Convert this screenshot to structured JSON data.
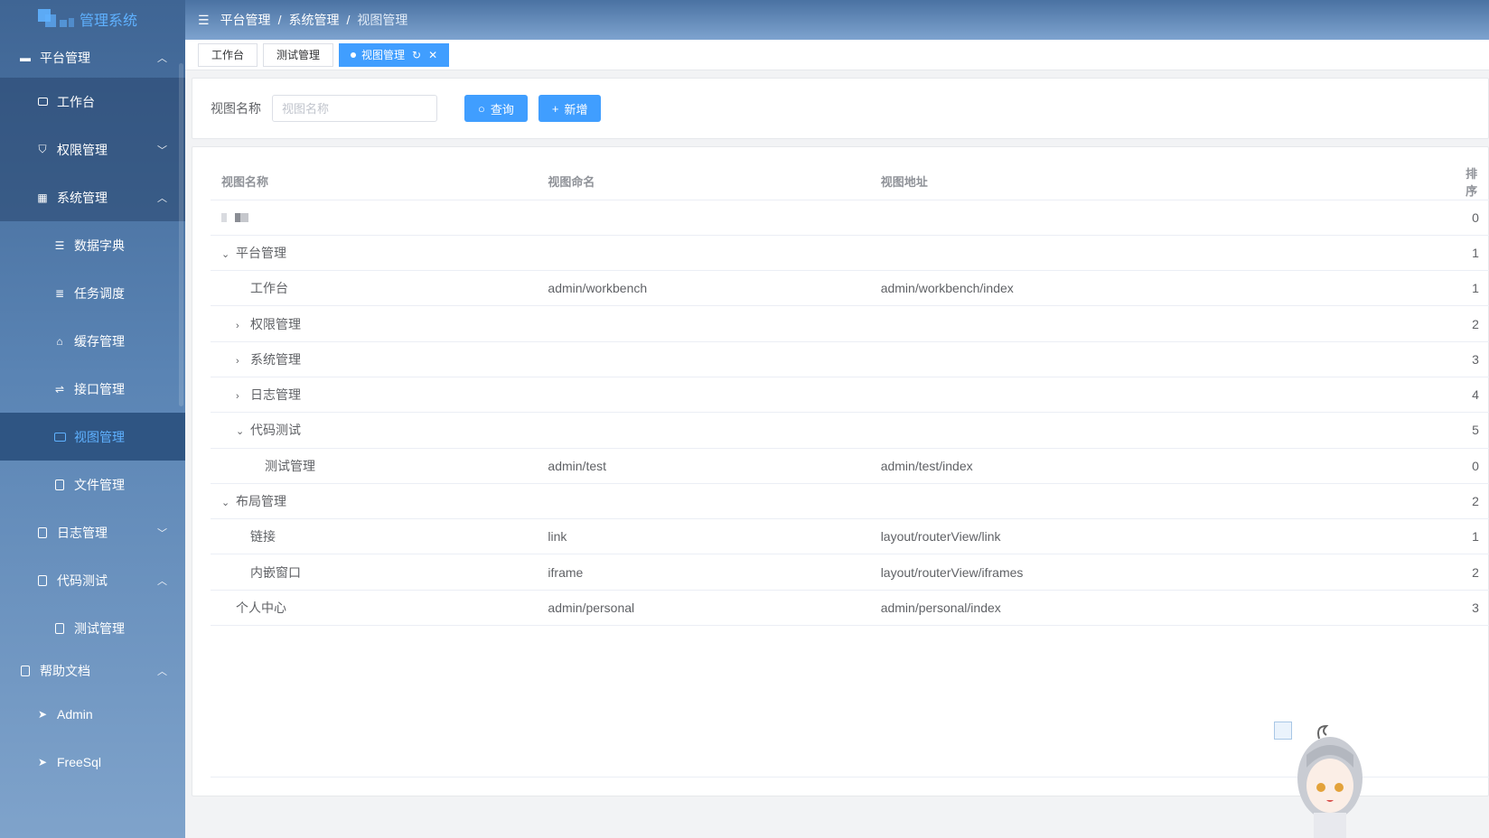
{
  "app": {
    "title": "管理系统"
  },
  "sidebar": {
    "items": [
      {
        "label": "平台管理",
        "icon": "monitor-icon",
        "arrow": "⌃"
      },
      {
        "label": "工作台",
        "icon": "dashboard-icon"
      },
      {
        "label": "权限管理",
        "icon": "shield-icon",
        "arrow": "⌄"
      },
      {
        "label": "系统管理",
        "icon": "windows-icon",
        "arrow": "⌃"
      },
      {
        "label": "数据字典",
        "icon": "database-icon"
      },
      {
        "label": "任务调度",
        "icon": "schedule-icon"
      },
      {
        "label": "缓存管理",
        "icon": "cache-icon"
      },
      {
        "label": "接口管理",
        "icon": "api-icon"
      },
      {
        "label": "视图管理",
        "icon": "view-icon"
      },
      {
        "label": "文件管理",
        "icon": "file-icon"
      },
      {
        "label": "日志管理",
        "icon": "log-icon",
        "arrow": "⌄"
      },
      {
        "label": "代码测试",
        "icon": "code-icon",
        "arrow": "⌃"
      },
      {
        "label": "测试管理",
        "icon": "test-icon"
      },
      {
        "label": "帮助文档",
        "icon": "book-icon",
        "arrow": "⌃"
      },
      {
        "label": "Admin",
        "icon": "send-icon"
      },
      {
        "label": "FreeSql",
        "icon": "send-icon"
      }
    ]
  },
  "header": {
    "breadcrumb": [
      "平台管理",
      "系统管理",
      "视图管理"
    ],
    "separator": "/"
  },
  "tabs": [
    {
      "label": "工作台"
    },
    {
      "label": "测试管理"
    },
    {
      "label": "视图管理",
      "active": true
    }
  ],
  "search": {
    "label": "视图名称",
    "placeholder": "视图名称",
    "query_button": "查询",
    "add_button": "新增"
  },
  "table": {
    "columns": [
      "视图名称",
      "视图命名",
      "视图地址",
      "排序"
    ],
    "rows": [
      {
        "name": "",
        "alias": "",
        "path": "",
        "sort": "0",
        "level": 0,
        "expand": ""
      },
      {
        "name": "平台管理",
        "alias": "",
        "path": "",
        "sort": "1",
        "level": 0,
        "expand": "⌄"
      },
      {
        "name": "工作台",
        "alias": "admin/workbench",
        "path": "admin/workbench/index",
        "sort": "1",
        "level": 2,
        "expand": ""
      },
      {
        "name": "权限管理",
        "alias": "",
        "path": "",
        "sort": "2",
        "level": 1,
        "expand": "›"
      },
      {
        "name": "系统管理",
        "alias": "",
        "path": "",
        "sort": "3",
        "level": 1,
        "expand": "›"
      },
      {
        "name": "日志管理",
        "alias": "",
        "path": "",
        "sort": "4",
        "level": 1,
        "expand": "›"
      },
      {
        "name": "代码测试",
        "alias": "",
        "path": "",
        "sort": "5",
        "level": 1,
        "expand": "⌄"
      },
      {
        "name": "测试管理",
        "alias": "admin/test",
        "path": "admin/test/index",
        "sort": "0",
        "level": 3,
        "expand": ""
      },
      {
        "name": "布局管理",
        "alias": "",
        "path": "",
        "sort": "2",
        "level": 0,
        "expand": "⌄"
      },
      {
        "name": "链接",
        "alias": "link",
        "path": "layout/routerView/link",
        "sort": "1",
        "level": 2,
        "expand": ""
      },
      {
        "name": "内嵌窗口",
        "alias": "iframe",
        "path": "layout/routerView/iframes",
        "sort": "2",
        "level": 2,
        "expand": ""
      },
      {
        "name": "个人中心",
        "alias": "admin/personal",
        "path": "admin/personal/index",
        "sort": "3",
        "level": 1,
        "expand": ""
      }
    ]
  }
}
